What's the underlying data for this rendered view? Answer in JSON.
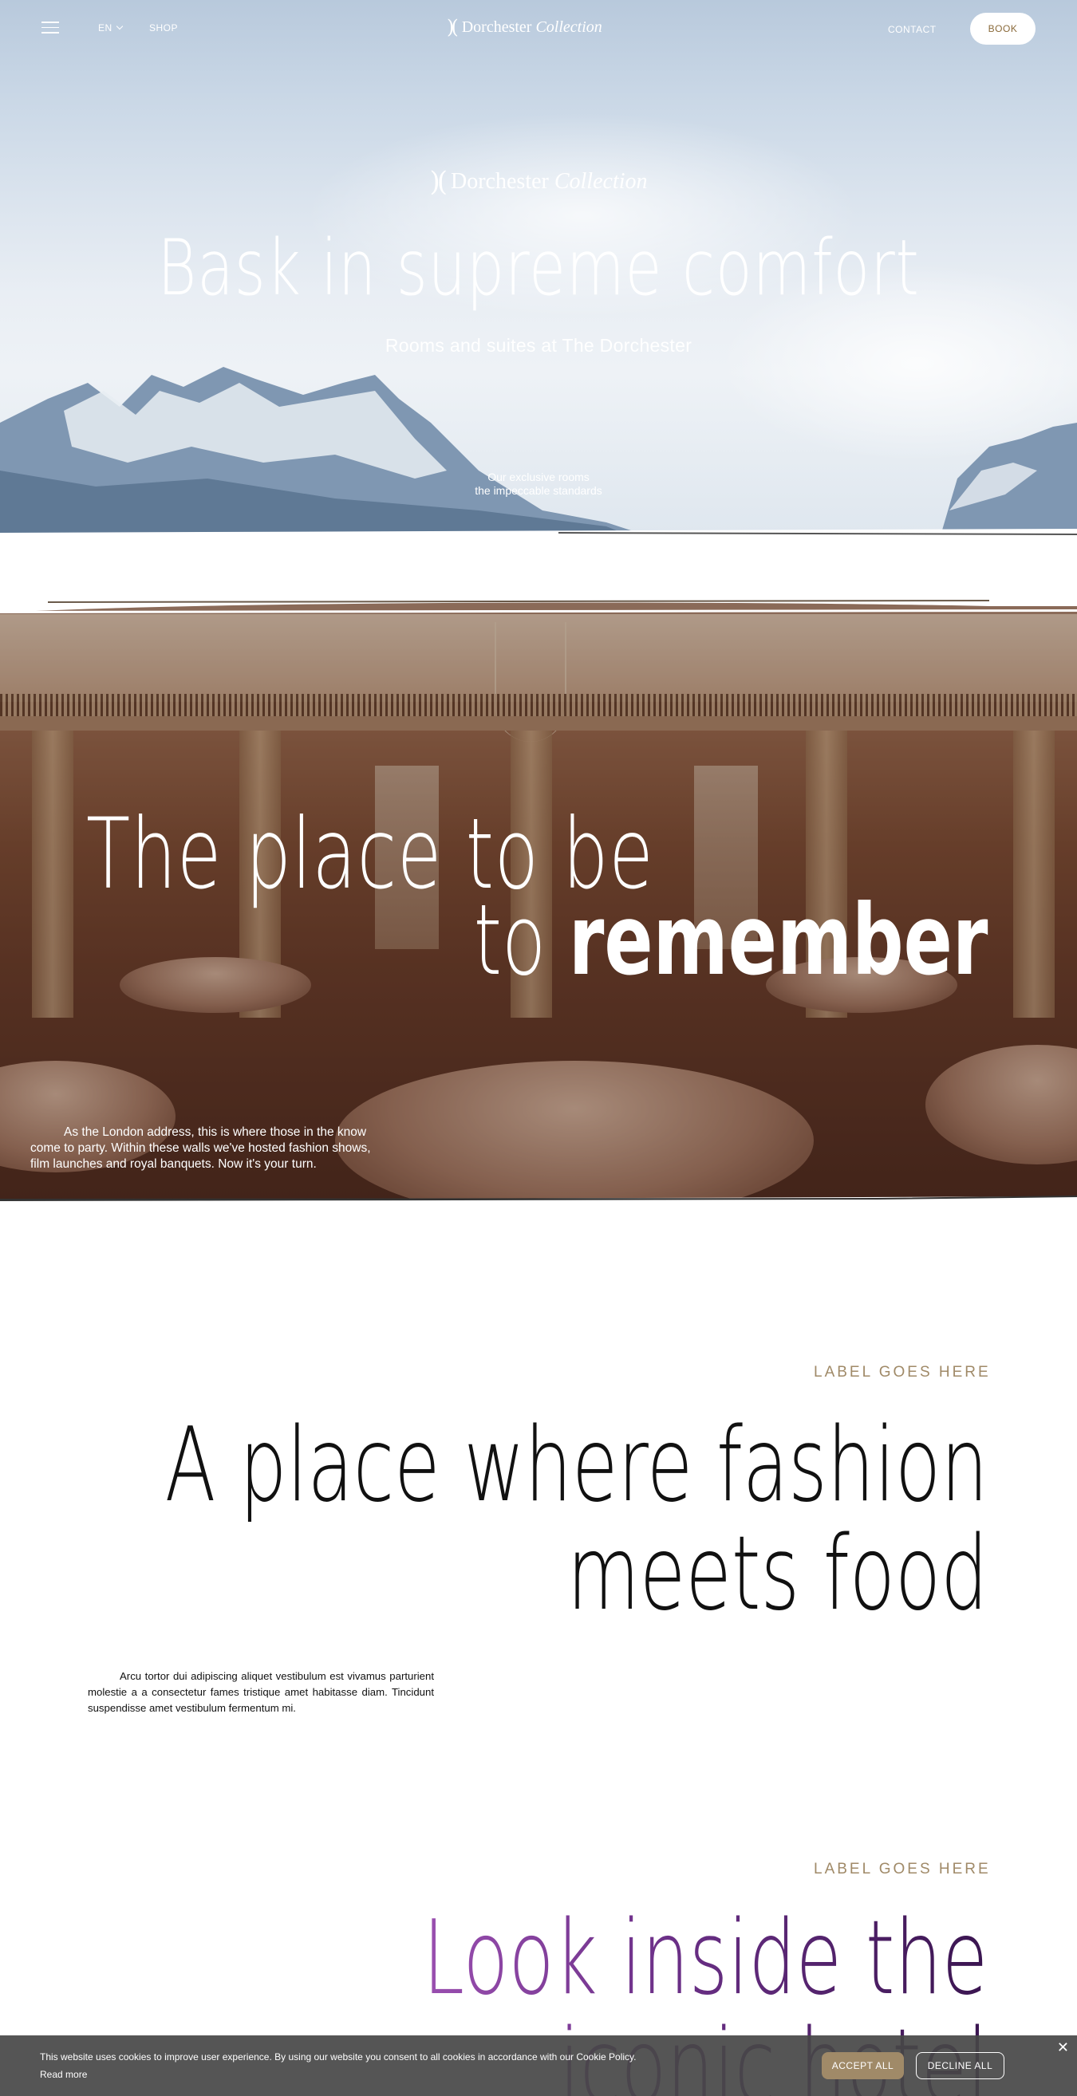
{
  "nav": {
    "language": "EN",
    "shop": "SHOP",
    "logo_name": "Dorchester",
    "logo_italic": "Collection",
    "contact": "CONTACT",
    "book": "BOOK"
  },
  "hero": {
    "logo_name": "Dorchester",
    "logo_italic": "Collection",
    "title": "Bask in supreme comfort",
    "subtitle": "Rooms and suites at The Dorchester",
    "body_line1": "Our exclusive rooms",
    "body_line2": "the impeccable standards"
  },
  "ballroom": {
    "title_line1": "The place to be",
    "title_line2_light": "to",
    "title_line2_bold": "remember",
    "body": "As the London address, this is where those in the know come to party. Within these walls we've hosted fashion shows, film launches and royal banquets. Now it's your turn."
  },
  "fashion": {
    "label": "LABEL GOES HERE",
    "title_line1": "A place where fashion",
    "title_line2": "meets food",
    "body": "Arcu tortor dui adipiscing aliquet vestibulum est vivamus parturient molestie a a consectetur fames tristique amet habitasse diam. Tincidunt suspendisse amet vestibulum fermentum mi."
  },
  "inside": {
    "label": "LABEL GOES HERE",
    "title_line1": "Look inside the",
    "title_line2": "iconic hotel"
  },
  "cookie": {
    "text": "This website uses cookies to improve user experience. By using our website you consent to all cookies in accordance with our Cookie Policy.",
    "read_more": "Read more",
    "accept": "ACCEPT ALL",
    "decline": "DECLINE ALL",
    "close": "✕"
  },
  "colors": {
    "accent_gold": "#a08a68",
    "title_purple": "#6a2f86",
    "cookie_bg": "#464646"
  },
  "icons": [
    "hamburger-menu-icon",
    "chevron-down-icon",
    "close-icon"
  ]
}
